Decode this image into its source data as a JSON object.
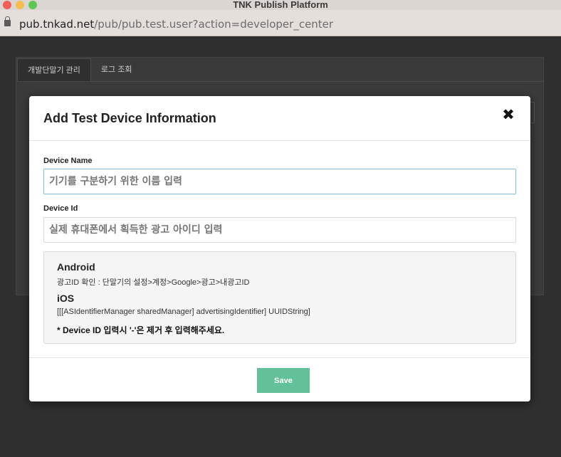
{
  "window": {
    "title": "TNK Publish Platform"
  },
  "browser": {
    "url_host": "pub.tnkad.net",
    "url_path": "/pub/pub.test.user?action=developer_center"
  },
  "background_page": {
    "tabs": [
      {
        "label": "개발단말기 관리"
      },
      {
        "label": "로그 조회"
      }
    ]
  },
  "modal": {
    "title": "Add Test Device Information",
    "device_name": {
      "label": "Device Name",
      "placeholder": "기기를 구분하기 위한 이름 입력"
    },
    "device_id": {
      "label": "Device Id",
      "placeholder": "실제 휴대폰에서 획득한 광고 아이디 입력"
    },
    "info": {
      "android_title": "Android",
      "android_text": "광고ID 확인 : 단말기의 설정>계정>Google>광고>내광고ID",
      "ios_title": "iOS",
      "ios_text": "[[[ASIdentifierManager sharedManager] advertisingIdentifier] UUIDString]",
      "note": "* Device ID 입력시 '-'은 제거 후 입력해주세요."
    },
    "save_label": "Save"
  },
  "colors": {
    "accent_save": "#63c19a",
    "placeholder_red": "#e4202d",
    "overlay": "#2f2f2f"
  }
}
